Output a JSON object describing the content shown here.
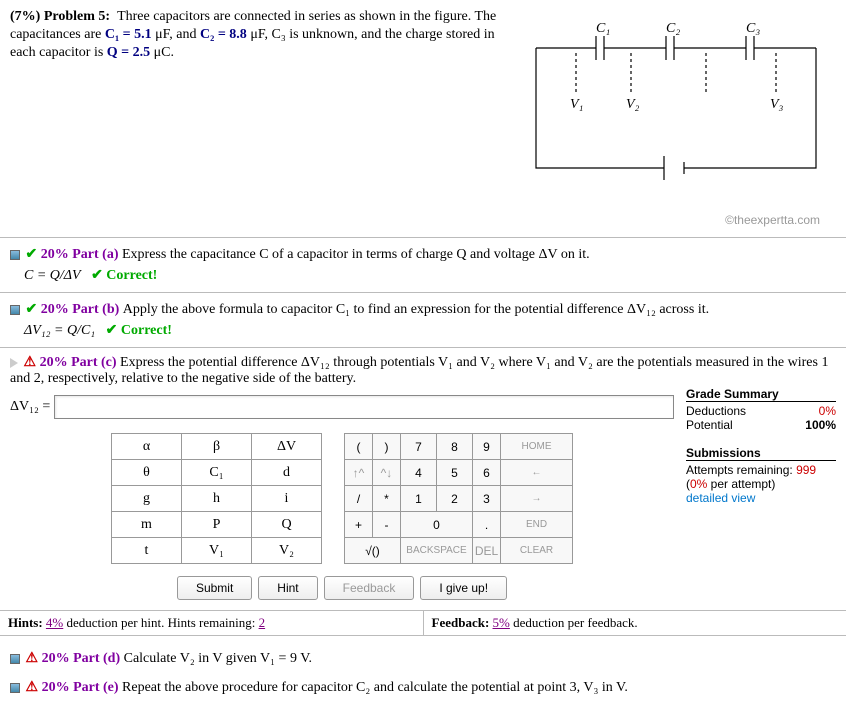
{
  "problem": {
    "percent_label": "(7%) Problem 5:",
    "text_1": "Three capacitors are connected in series as shown in the figure. The capacitances are ",
    "c1": "C₁ = 5.1",
    "unit1": " μF, and ",
    "c2": "C₂ = 8.8",
    "unit2": " μF, ",
    "c3txt": "C₃ is unknown, and the charge stored in each capacitor is ",
    "q": "Q = 2.5",
    "unit3": " μC."
  },
  "circuit": {
    "c1": "C₁",
    "c2": "C₂",
    "c3": "C₃",
    "v1": "V₁",
    "v2": "V₂",
    "v3": "V₃",
    "copyright": "©theexpertta.com"
  },
  "parts": {
    "a": {
      "pct": "20% Part (a)",
      "txt": "Express the capacitance C of a capacitor in terms of charge Q and voltage ΔV on it.",
      "ans": "C = Q/ΔV",
      "correct": "✔ Correct!"
    },
    "b": {
      "pct": "20% Part (b)",
      "txt": "Apply the above formula to capacitor C₁ to find an expression for the potential difference ΔV₁₂ across it.",
      "ans": "ΔV₁₂ = Q/C₁",
      "correct": "✔ Correct!"
    },
    "c": {
      "pct": "20% Part (c)",
      "txt": "Express the potential difference ΔV₁₂ through potentials V₁ and V₂ where V₁ and V₂ are the potentials measured in the wires 1 and 2, respectively, relative to the negative side of the battery.",
      "label": "ΔV₁₂ = "
    },
    "d": {
      "pct": "20% Part (d)",
      "txt": "Calculate V₂ in V given V₁ = 9 V."
    },
    "e": {
      "pct": "20% Part (e)",
      "txt": "Repeat the above procedure for capacitor C₂ and calculate the potential at point 3, V₃ in V."
    }
  },
  "grade": {
    "hdr": "Grade Summary",
    "ded_lbl": "Deductions",
    "ded_val": "0%",
    "pot_lbl": "Potential",
    "pot_val": "100%",
    "sub_hdr": "Submissions",
    "att_lbl": "Attempts remaining:",
    "att_val": "999",
    "per": "(0% per attempt)",
    "detail": "detailed view"
  },
  "vars": [
    [
      "α",
      "β",
      "ΔV"
    ],
    [
      "θ",
      "C₁",
      "d"
    ],
    [
      "g",
      "h",
      "i"
    ],
    [
      "m",
      "P",
      "Q"
    ],
    [
      "t",
      "V₁",
      "V₂"
    ]
  ],
  "nums": {
    "r1": [
      "(",
      ")",
      "7",
      "8",
      "9",
      "HOME"
    ],
    "r2": [
      "↑^",
      "^↓",
      "4",
      "5",
      "6",
      "←"
    ],
    "r3": [
      "/",
      "*",
      "1",
      "2",
      "3",
      "→"
    ],
    "r4": [
      "+",
      "-",
      "0",
      ".",
      "END"
    ],
    "r5": [
      "√()",
      "BACKSPACE",
      "DEL",
      "CLEAR"
    ]
  },
  "btns": {
    "submit": "Submit",
    "hint": "Hint",
    "feedback": "Feedback",
    "giveup": "I give up!"
  },
  "hints": {
    "left_a": "Hints: ",
    "left_pct": "4%",
    "left_b": " deduction per hint. Hints remaining: ",
    "left_rem": "2",
    "right_a": "Feedback: ",
    "right_pct": "5%",
    "right_b": " deduction per feedback."
  }
}
